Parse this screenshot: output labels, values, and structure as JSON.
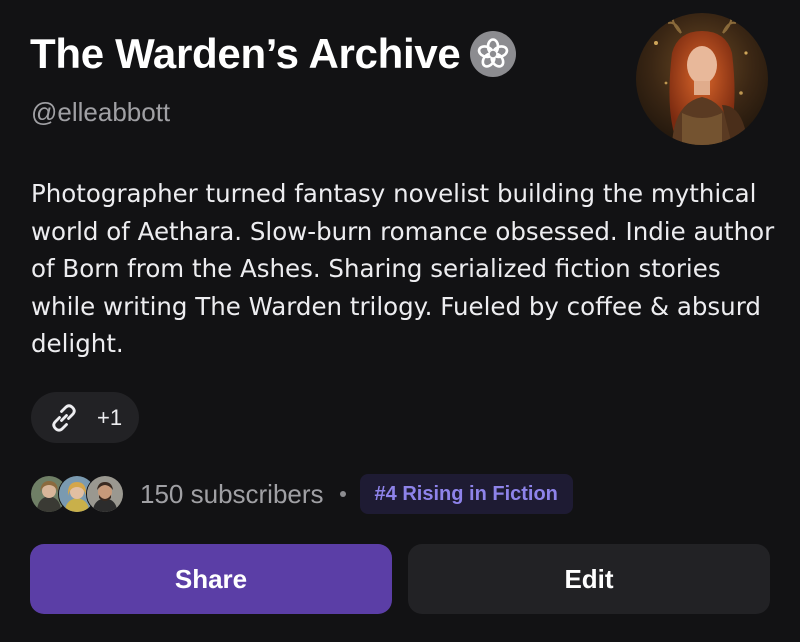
{
  "profile": {
    "title": "The Warden’s Archive",
    "handle": "@elleabbott",
    "bio": "Photographer turned fantasy novelist building the mythical world of Aethara. Slow-burn romance obsessed. Indie author of Born from the Ashes. Sharing serialized fiction stories while writing The Warden trilogy. Fueled by coffee & absurd delight.",
    "verified_icon": "flower-badge-icon",
    "avatar_icon": "profile-photo"
  },
  "links": {
    "icon": "link-icon",
    "more_label": "+1"
  },
  "stats": {
    "subscribers_label": "150 subscribers",
    "rank_label": "#4 Rising in Fiction",
    "subscriber_avatars": [
      "subscriber-avatar-1",
      "subscriber-avatar-2",
      "subscriber-avatar-3"
    ]
  },
  "actions": {
    "share_label": "Share",
    "edit_label": "Edit"
  },
  "colors": {
    "background": "#121214",
    "accent": "#5b3ea6",
    "rank_text": "#8e83ea",
    "secondary_text": "#a0a0a4"
  }
}
